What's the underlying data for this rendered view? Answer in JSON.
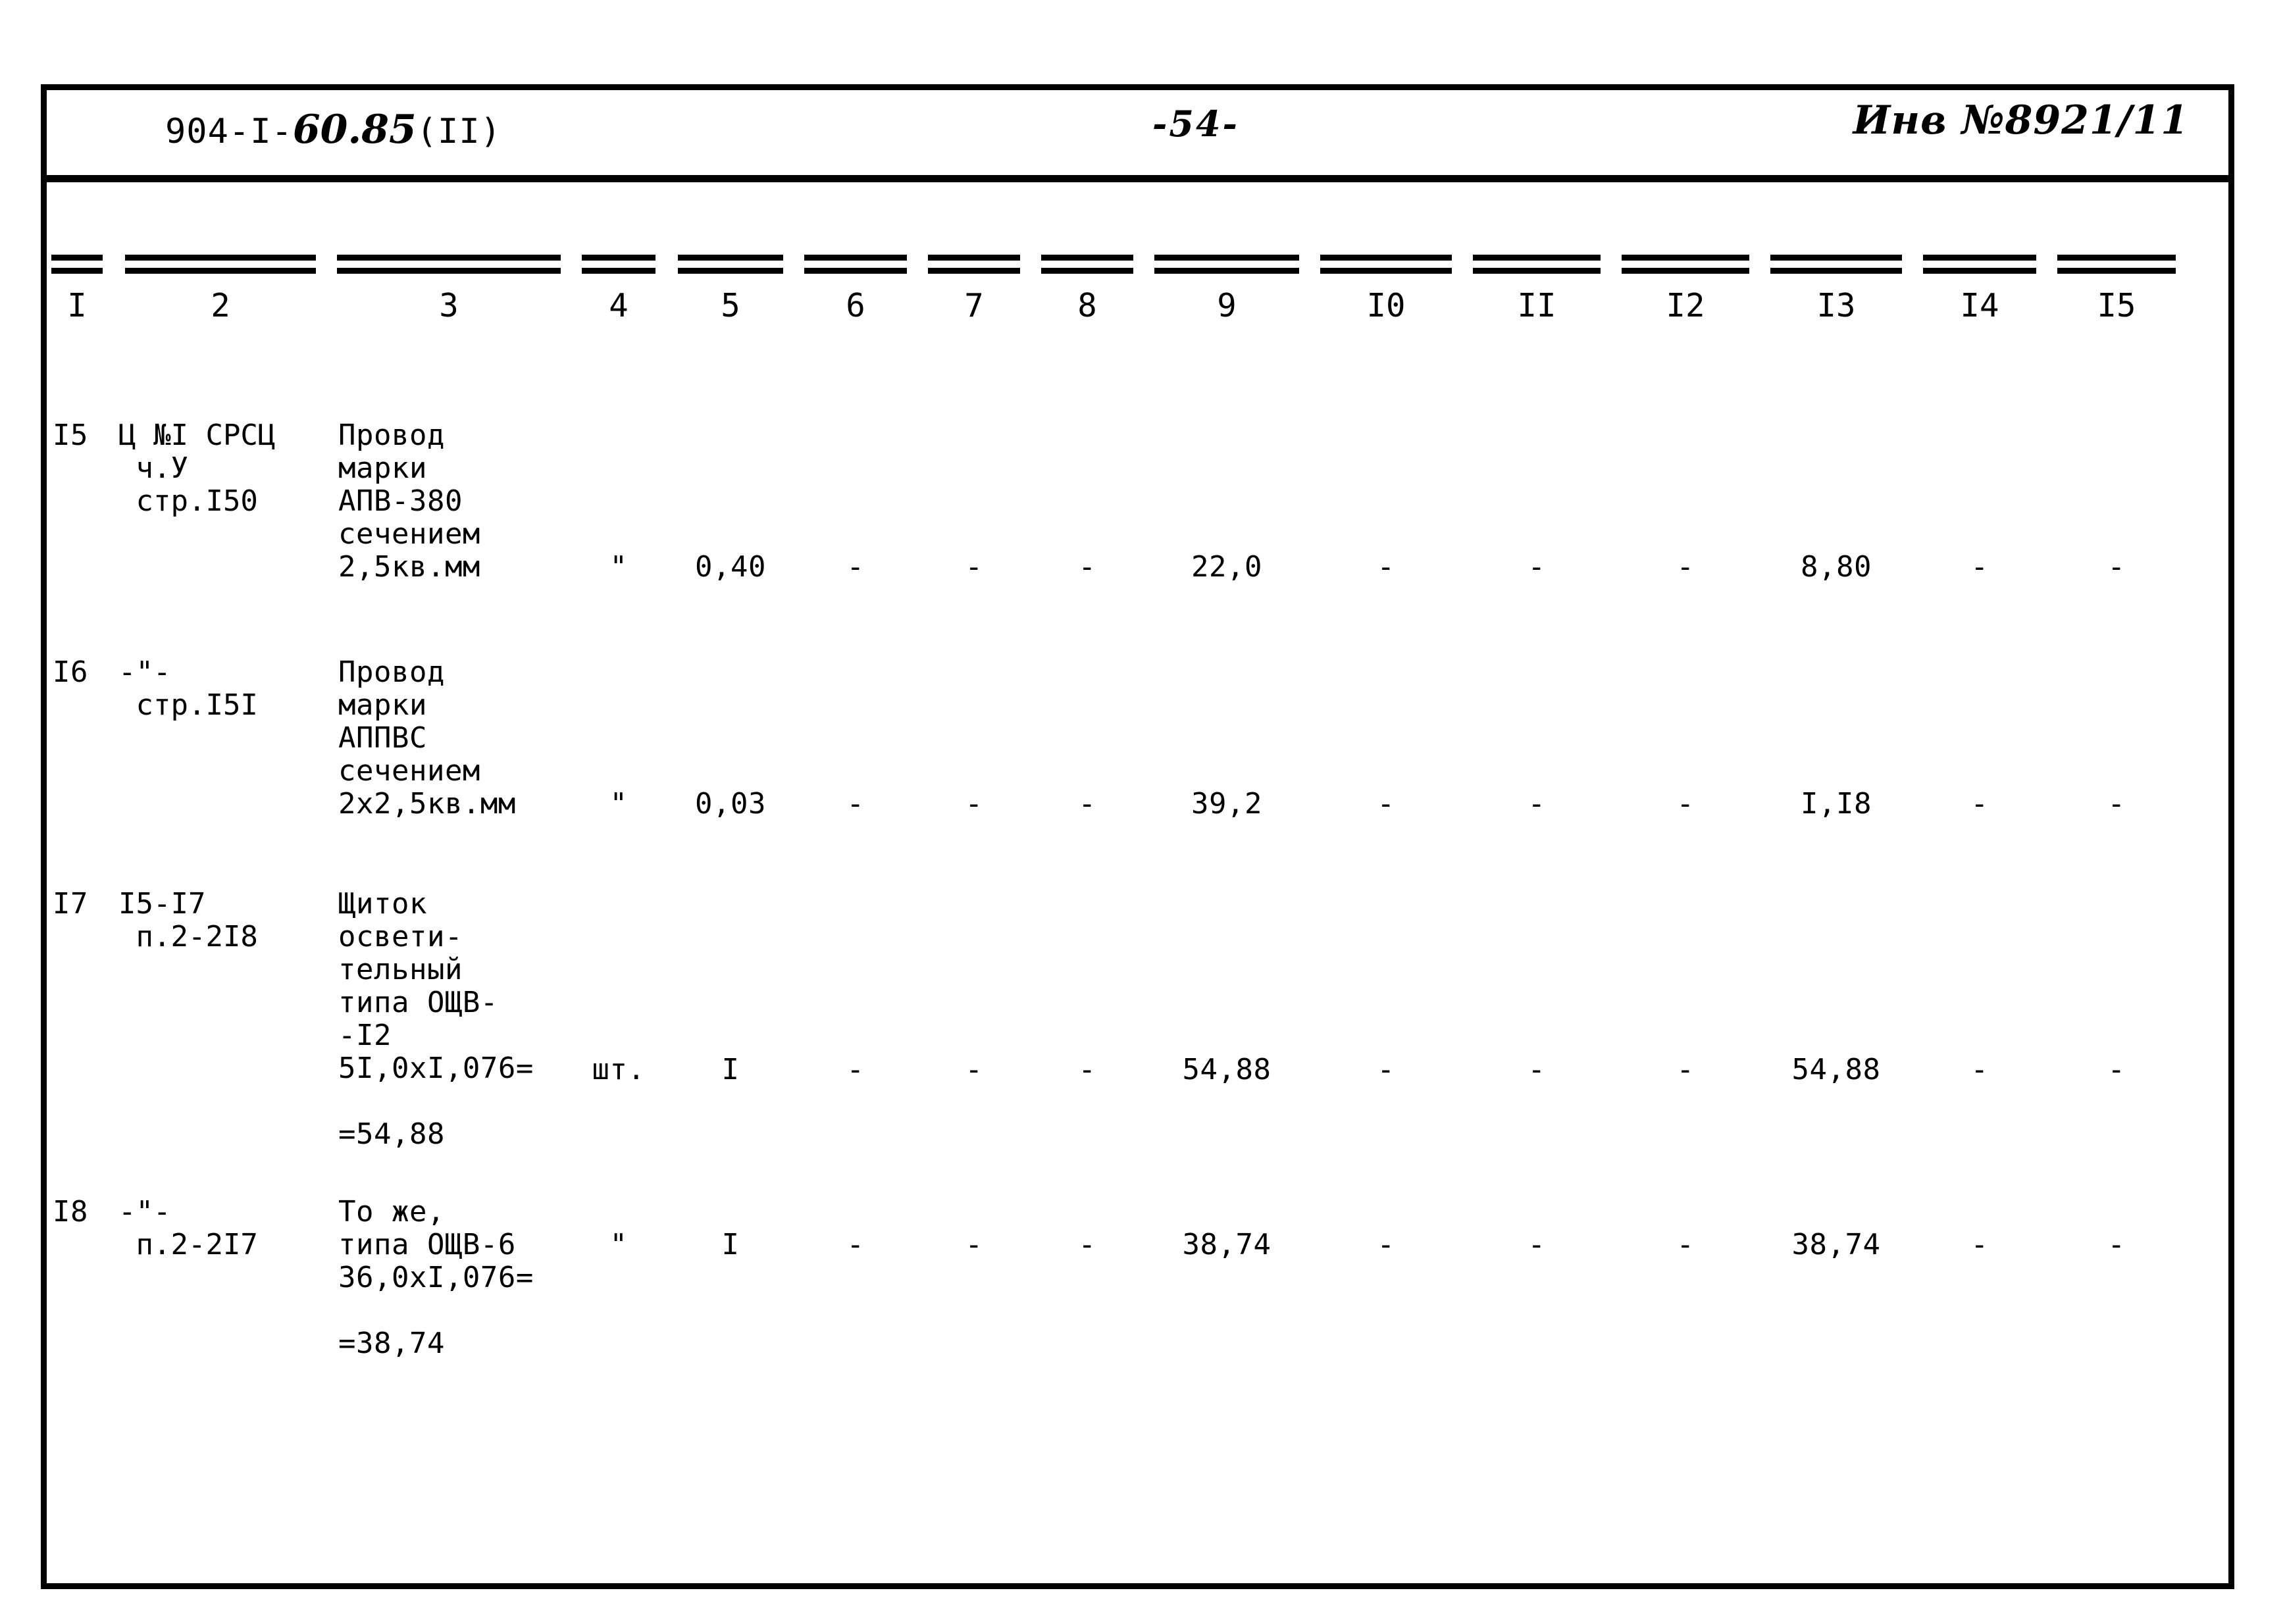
{
  "header": {
    "doc_code_prefix": "904-I-",
    "doc_code_hand": "60.85",
    "doc_code_suffix": "(II)",
    "page_number": "-54-",
    "inventory_number": "Инв №8921/11"
  },
  "table": {
    "column_headers": [
      "I",
      "2",
      "3",
      "4",
      "5",
      "6",
      "7",
      "8",
      "9",
      "I0",
      "II",
      "I2",
      "I3",
      "I4",
      "I5"
    ],
    "rows": [
      {
        "pos": "I5",
        "justification": "Ц №I СРСЦ\n ч.У\n стр.I50",
        "description": "Провод\nмарки\nАПВ-380\nсечением\n2,5кв.мм",
        "unit": "\"",
        "qty": "0,40",
        "c6": "-",
        "c7": "-",
        "c8": "-",
        "c9": "22,0",
        "c10": "-",
        "c11": "-",
        "c12": "-",
        "c13": "8,80",
        "c14": "-",
        "c15": "-"
      },
      {
        "pos": "I6",
        "justification": "-\"-\n стр.I5I",
        "description": "Провод\nмарки\nАППВС\nсечением\n2х2,5кв.мм",
        "unit": "\"",
        "qty": "0,03",
        "c6": "-",
        "c7": "-",
        "c8": "-",
        "c9": "39,2",
        "c10": "-",
        "c11": "-",
        "c12": "-",
        "c13": "I,I8",
        "c14": "-",
        "c15": "-"
      },
      {
        "pos": "I7",
        "justification": "I5-I7\n п.2-2I8",
        "description": "Щиток\nосвети-\nтельный\nтипа ОЩВ-\n-I2\n5I,0хI,076=\n\n=54,88",
        "unit": "шт.",
        "qty": "I",
        "c6": "-",
        "c7": "-",
        "c8": "-",
        "c9": "54,88",
        "c10": "-",
        "c11": "-",
        "c12": "-",
        "c13": "54,88",
        "c14": "-",
        "c15": "-"
      },
      {
        "pos": "I8",
        "justification": "-\"-\n п.2-2I7",
        "description": "То же,\nтипа ОЩВ-6\n36,0хI,076=\n\n=38,74",
        "unit": "\"",
        "qty": "I",
        "c6": "-",
        "c7": "-",
        "c8": "-",
        "c9": "38,74",
        "c10": "-",
        "c11": "-",
        "c12": "-",
        "c13": "38,74",
        "c14": "-",
        "c15": "-"
      }
    ]
  }
}
